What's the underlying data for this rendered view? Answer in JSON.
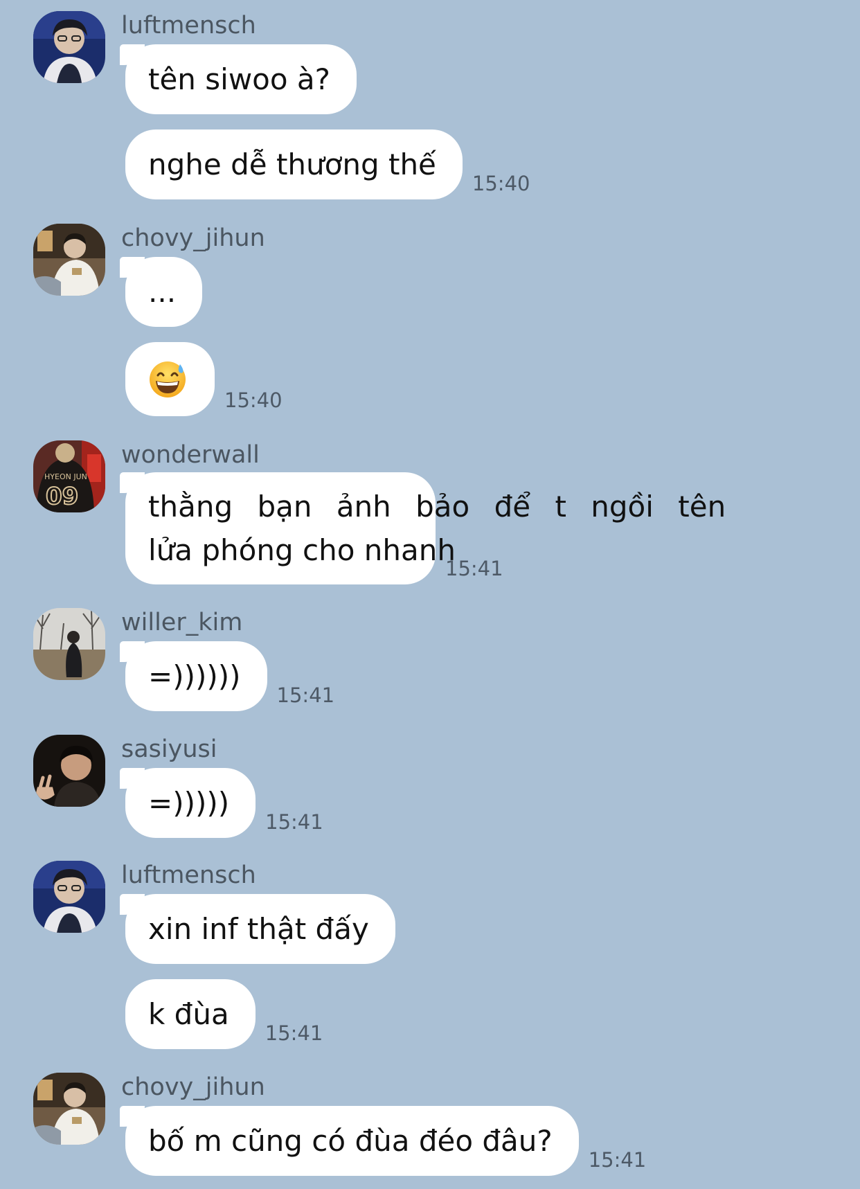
{
  "colors": {
    "background": "#aac0d5",
    "bubble": "#ffffff",
    "sender_text": "#4b5661",
    "time_text": "#4d5966"
  },
  "groups": [
    {
      "sender": "luftmensch",
      "avatar": "avatar-luftmensch",
      "messages": [
        {
          "text": "tên siwoo à?",
          "time": ""
        },
        {
          "text": "nghe dễ thương thế",
          "time": "15:40"
        }
      ]
    },
    {
      "sender": "chovy_jihun",
      "avatar": "avatar-chovy-jihun",
      "messages": [
        {
          "text": "...",
          "time": ""
        },
        {
          "emoji": "grinning-face-with-sweat-emoji",
          "time": "15:40"
        }
      ]
    },
    {
      "sender": "wonderwall",
      "avatar": "avatar-wonderwall",
      "messages": [
        {
          "lines": [
            "thằng bạn ảnh bảo để t ngồi tên",
            "lửa phóng cho nhanh"
          ],
          "time": "15:41"
        }
      ]
    },
    {
      "sender": "willer_kim",
      "avatar": "avatar-willer-kim",
      "messages": [
        {
          "text": "=))))))",
          "time": "15:41"
        }
      ]
    },
    {
      "sender": "sasiyusi",
      "avatar": "avatar-sasiyusi",
      "messages": [
        {
          "text": "=)))))",
          "time": "15:41"
        }
      ]
    },
    {
      "sender": "luftmensch",
      "avatar": "avatar-luftmensch",
      "messages": [
        {
          "text": "xin inf thật đấy",
          "time": ""
        },
        {
          "text": "k đùa",
          "time": "15:41"
        }
      ]
    },
    {
      "sender": "chovy_jihun",
      "avatar": "avatar-chovy-jihun",
      "messages": [
        {
          "text": "bố m cũng có đùa đéo đâu?",
          "time": "15:41"
        }
      ]
    }
  ]
}
